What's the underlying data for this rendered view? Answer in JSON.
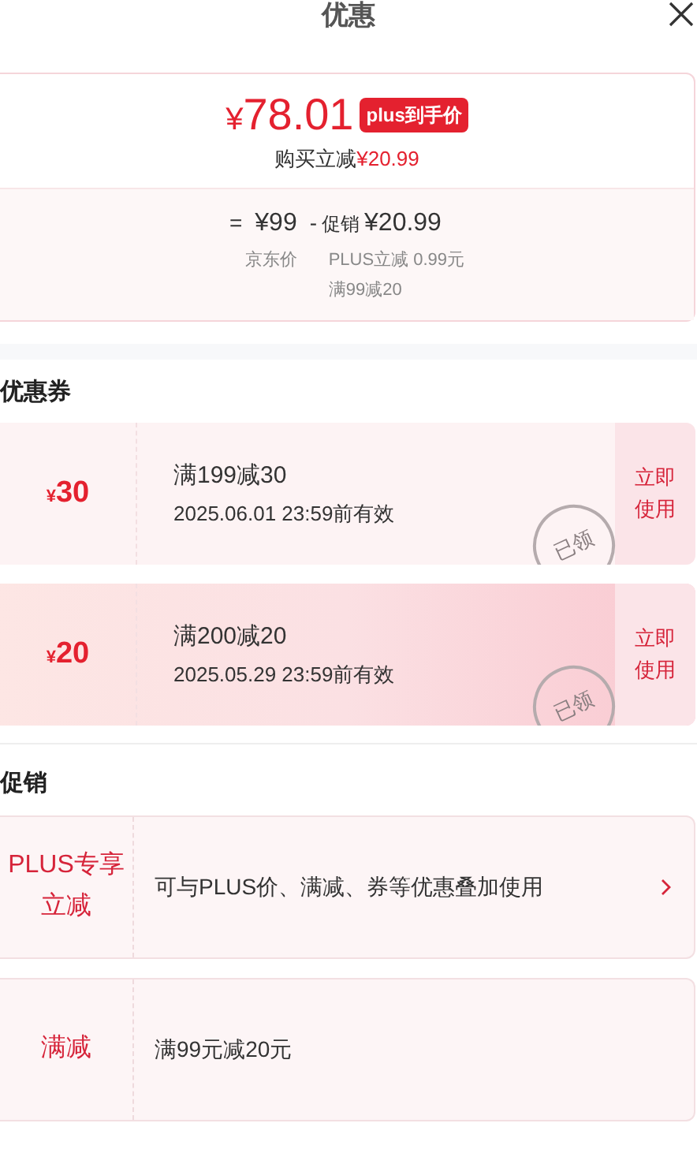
{
  "title": "优惠",
  "price": {
    "amount": "78.01",
    "currency": "¥",
    "badge": "plus到手价",
    "saving_label": "购买立减",
    "saving_amount": "¥20.99"
  },
  "breakdown": {
    "equals": "=",
    "base_price": "¥99",
    "base_label": "京东价",
    "minus": "-",
    "promo_label": "促销",
    "promo_amount": "¥20.99",
    "details": [
      "PLUS立减 0.99元",
      "满99减20"
    ]
  },
  "coupons_heading": "优惠券",
  "coupons": [
    {
      "currency": "¥",
      "amount": "30",
      "condition": "满199减30",
      "validity": "2025.06.01 23:59前有效",
      "action": "立即使用",
      "stamp": "已领",
      "highlighted": false
    },
    {
      "currency": "¥",
      "amount": "20",
      "condition": "满200减20",
      "validity": "2025.05.29 23:59前有效",
      "action": "立即使用",
      "stamp": "已领",
      "highlighted": true
    }
  ],
  "promotions_heading": "促销",
  "promotions": [
    {
      "label": "PLUS专享立减",
      "description": "可与PLUS价、满减、券等优惠叠加使用",
      "has_arrow": true
    },
    {
      "label": "满减",
      "description": "满99元减20元",
      "has_arrow": false
    }
  ]
}
